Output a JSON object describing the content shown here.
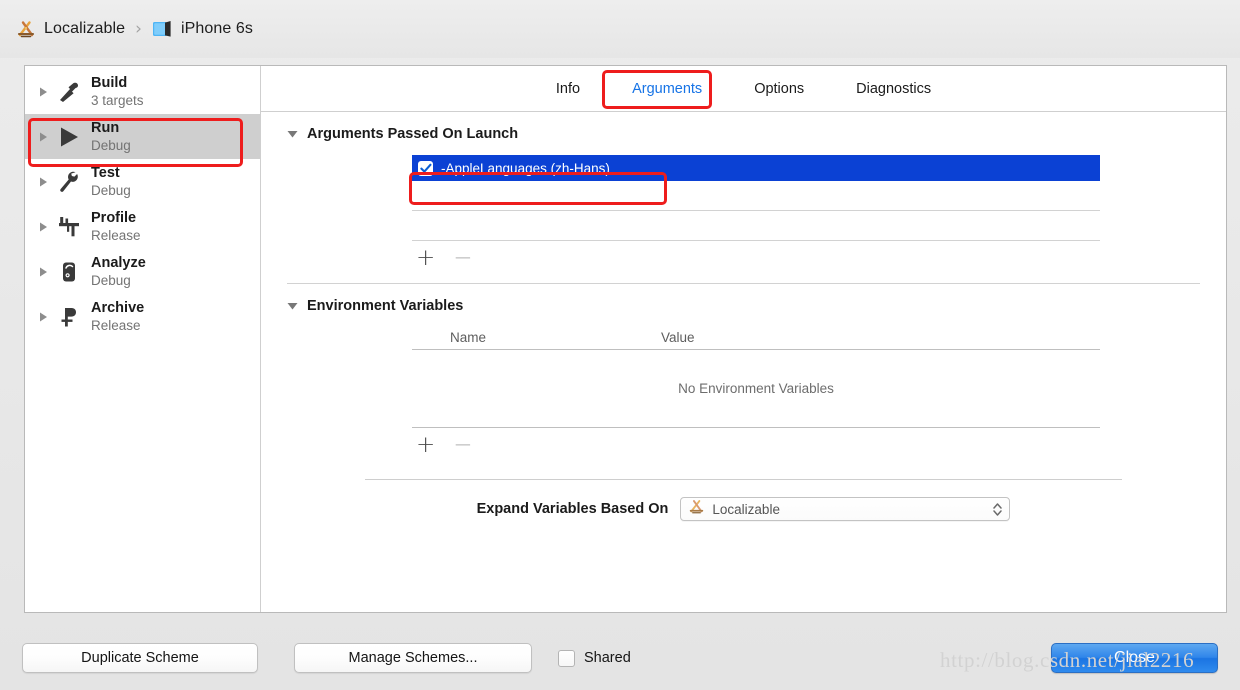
{
  "titlebar": {
    "scheme_icon": "xcode-app-icon",
    "scheme_name": "Localizable",
    "separator": "›",
    "destination_icon": "simulator-icon",
    "destination_name": "iPhone 6s"
  },
  "sidebar": {
    "items": [
      {
        "title": "Build",
        "subtitle": "3 targets",
        "icon": "hammer-icon",
        "selected": false
      },
      {
        "title": "Run",
        "subtitle": "Debug",
        "icon": "play-icon",
        "selected": true
      },
      {
        "title": "Test",
        "subtitle": "Debug",
        "icon": "wrench-icon",
        "selected": false
      },
      {
        "title": "Profile",
        "subtitle": "Release",
        "icon": "caliper-icon",
        "selected": false
      },
      {
        "title": "Analyze",
        "subtitle": "Debug",
        "icon": "stethoscope-icon",
        "selected": false
      },
      {
        "title": "Archive",
        "subtitle": "Release",
        "icon": "archive-icon",
        "selected": false
      }
    ]
  },
  "tabs": [
    {
      "label": "Info",
      "active": false
    },
    {
      "label": "Arguments",
      "active": true
    },
    {
      "label": "Options",
      "active": false
    },
    {
      "label": "Diagnostics",
      "active": false
    }
  ],
  "arguments_section": {
    "title": "Arguments Passed On Launch",
    "disclosure": "expanded",
    "rows": [
      {
        "checked": true,
        "text": "-AppleLanguages (zh-Hans)",
        "selected": true
      }
    ],
    "add_label": "+",
    "remove_label": "−"
  },
  "environment_section": {
    "title": "Environment Variables",
    "disclosure": "expanded",
    "columns": {
      "name": "Name",
      "value": "Value"
    },
    "empty_message": "No Environment Variables",
    "add_label": "+",
    "remove_label": "−"
  },
  "expand_variables": {
    "label": "Expand Variables Based On",
    "selected_value": "Localizable",
    "value_icon": "xcode-app-icon"
  },
  "bottom_bar": {
    "duplicate_scheme": "Duplicate Scheme",
    "manage_schemes": "Manage Schemes...",
    "shared_label": "Shared",
    "shared_checked": false,
    "close": "Close"
  },
  "annotations": {
    "highlight_color": "#ee1d1d",
    "targets": [
      "run-scheme-row",
      "arguments-tab",
      "apple-languages-argument-row"
    ]
  },
  "watermark": "http://blog.csdn.net/jial2216",
  "colors": {
    "selection_blue": "#0b41d4",
    "active_tab_blue": "#1673e6",
    "sidebar_selected_gray": "#cfcfcf",
    "close_button_blue": "#2f85ea"
  }
}
